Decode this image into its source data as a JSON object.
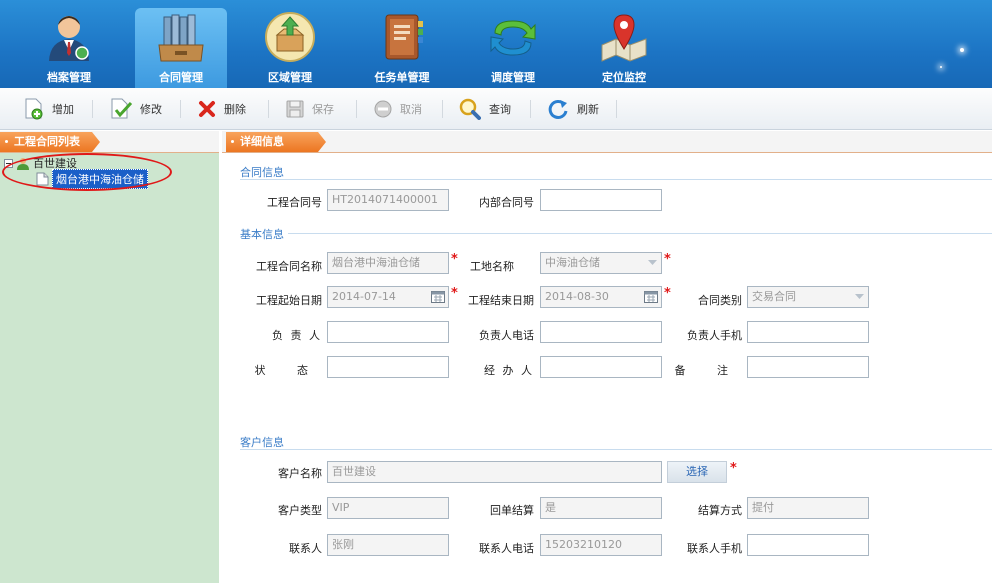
{
  "nav": {
    "items": [
      {
        "label": "档案管理",
        "icon": "user-profile-icon",
        "active": false
      },
      {
        "label": "合同管理",
        "icon": "contract-binders-icon",
        "active": true
      },
      {
        "label": "区域管理",
        "icon": "area-box-icon",
        "active": false
      },
      {
        "label": "任务单管理",
        "icon": "task-notebook-icon",
        "active": false
      },
      {
        "label": "调度管理",
        "icon": "dispatch-arrows-icon",
        "active": false
      },
      {
        "label": "定位监控",
        "icon": "map-pin-icon",
        "active": false
      }
    ]
  },
  "toolbar": {
    "add": "增加",
    "edit": "修改",
    "delete": "删除",
    "save": "保存",
    "cancel": "取消",
    "query": "查询",
    "refresh": "刷新"
  },
  "left_panel": {
    "title": "工程合同列表",
    "tree": {
      "root": "百世建设",
      "children": [
        "烟台港中海油仓储"
      ]
    }
  },
  "detail": {
    "title": "详细信息",
    "sections": {
      "contract": "合同信息",
      "basic": "基本信息",
      "customer": "客户信息"
    },
    "fields": {
      "project_contract_no": {
        "label": "工程合同号",
        "value": "HT2014071400001"
      },
      "internal_contract_no": {
        "label": "内部合同号",
        "value": ""
      },
      "project_contract_name": {
        "label": "工程合同名称",
        "value": "烟台港中海油仓储"
      },
      "site_name": {
        "label": "工地名称",
        "value": "中海油仓储"
      },
      "start_date": {
        "label": "工程起始日期",
        "value": "2014-07-14"
      },
      "end_date": {
        "label": "工程结束日期",
        "value": "2014-08-30"
      },
      "contract_type": {
        "label": "合同类别",
        "value": "交易合同"
      },
      "manager": {
        "label": "负 责 人",
        "value": ""
      },
      "manager_phone": {
        "label": "负责人电话",
        "value": ""
      },
      "manager_mobile": {
        "label": "负责人手机",
        "value": ""
      },
      "status": {
        "label": "状 态",
        "value": ""
      },
      "handler": {
        "label": "经 办 人",
        "value": ""
      },
      "remark": {
        "label": "备 注",
        "value": ""
      },
      "customer_name": {
        "label": "客户名称",
        "value": "百世建设"
      },
      "customer_type": {
        "label": "客户类型",
        "value": "VIP"
      },
      "receipt_settlement": {
        "label": "回单结算",
        "value": "是"
      },
      "settlement_method": {
        "label": "结算方式",
        "value": "提付"
      },
      "contact": {
        "label": "联系人",
        "value": "张刚"
      },
      "contact_phone": {
        "label": "联系人电话",
        "value": "15203210120"
      },
      "contact_mobile": {
        "label": "联系人手机",
        "value": ""
      }
    },
    "select_button": "选择",
    "required_mark": "*"
  },
  "colors": {
    "nav_blue": "#1c74c4",
    "tab_orange": "#ec7622",
    "tree_bg": "#cde6cf",
    "required_red": "#e01818",
    "highlight_circle": "#e01818",
    "section_blue": "#3a7cc7"
  }
}
